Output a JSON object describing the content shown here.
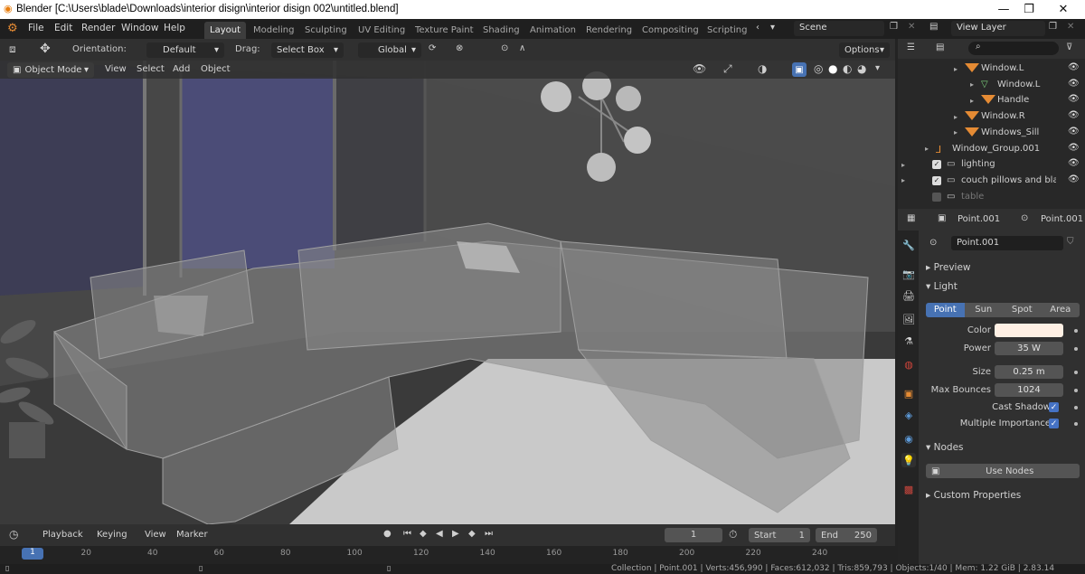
{
  "window": {
    "title": "Blender [C:\\Users\\blade\\Downloads\\interior disign\\interior disign 002\\untitled.blend]",
    "minimize": "—",
    "maximize": "❐",
    "close": "✕"
  },
  "menu": [
    "File",
    "Edit",
    "Render",
    "Window",
    "Help"
  ],
  "workspaces": [
    "Layout",
    "Modeling",
    "Sculpting",
    "UV Editing",
    "Texture Paint",
    "Shading",
    "Animation",
    "Rendering",
    "Compositing",
    "Scripting"
  ],
  "scene": {
    "label": "Scene",
    "view_layer": "View Layer"
  },
  "header": {
    "orientation_label": "Orientation:",
    "orientation_value": "Default",
    "drag_label": "Drag:",
    "drag_value": "Select Box",
    "transform": "Global",
    "options": "Options"
  },
  "viewport_header": {
    "mode": "Object Mode",
    "menu": [
      "View",
      "Select",
      "Add",
      "Object"
    ]
  },
  "outliner": [
    {
      "name": "Window.L",
      "indent": 72,
      "type": "mesh"
    },
    {
      "name": "Window.L",
      "indent": 90,
      "type": "data"
    },
    {
      "name": "Handle",
      "indent": 90,
      "type": "mesh"
    },
    {
      "name": "Window.R",
      "indent": 72,
      "type": "mesh"
    },
    {
      "name": "Windows_Sill",
      "indent": 72,
      "type": "mesh"
    },
    {
      "name": "Window_Group.001",
      "indent": 40,
      "type": "empty"
    },
    {
      "name": "lighting",
      "indent": 20,
      "type": "collection"
    },
    {
      "name": "couch pillows and blackets",
      "indent": 20,
      "type": "collection"
    },
    {
      "name": "table",
      "indent": 20,
      "type": "collection-off"
    }
  ],
  "properties": {
    "object_name": "Point.001",
    "data_name": "Point.001",
    "datablock": "Point.001",
    "sections": {
      "preview": "Preview",
      "light": "Light",
      "nodes": "Nodes",
      "custom": "Custom Properties"
    },
    "light_types": [
      "Point",
      "Sun",
      "Spot",
      "Area"
    ],
    "fields": [
      {
        "label": "Color",
        "value": "",
        "type": "color"
      },
      {
        "label": "Power",
        "value": "35 W",
        "type": "num"
      },
      {
        "label": "Size",
        "value": "0.25 m",
        "type": "num"
      },
      {
        "label": "Max Bounces",
        "value": "1024",
        "type": "num"
      },
      {
        "label": "Cast Shadow",
        "value": "✓",
        "type": "check"
      },
      {
        "label": "Multiple Importance",
        "value": "✓",
        "type": "check"
      }
    ],
    "use_nodes": "Use Nodes"
  },
  "timeline": {
    "menu": [
      "Playback",
      "Keying",
      "View",
      "Marker"
    ],
    "current": "1",
    "start_label": "Start",
    "start": "1",
    "end_label": "End",
    "end": "250",
    "ticks": [
      "0",
      "20",
      "40",
      "60",
      "80",
      "100",
      "120",
      "140",
      "160",
      "180",
      "200",
      "220",
      "240"
    ],
    "current_marker": "1"
  },
  "status": "Collection | Point.001 | Verts:456,990 | Faces:612,032 | Tris:859,793 | Objects:1/40 | Mem: 1.22 GiB | 2.83.14",
  "colors": {
    "accent": "#4772b3",
    "orange": "#e58b34",
    "light_color": "#fff0e4"
  }
}
